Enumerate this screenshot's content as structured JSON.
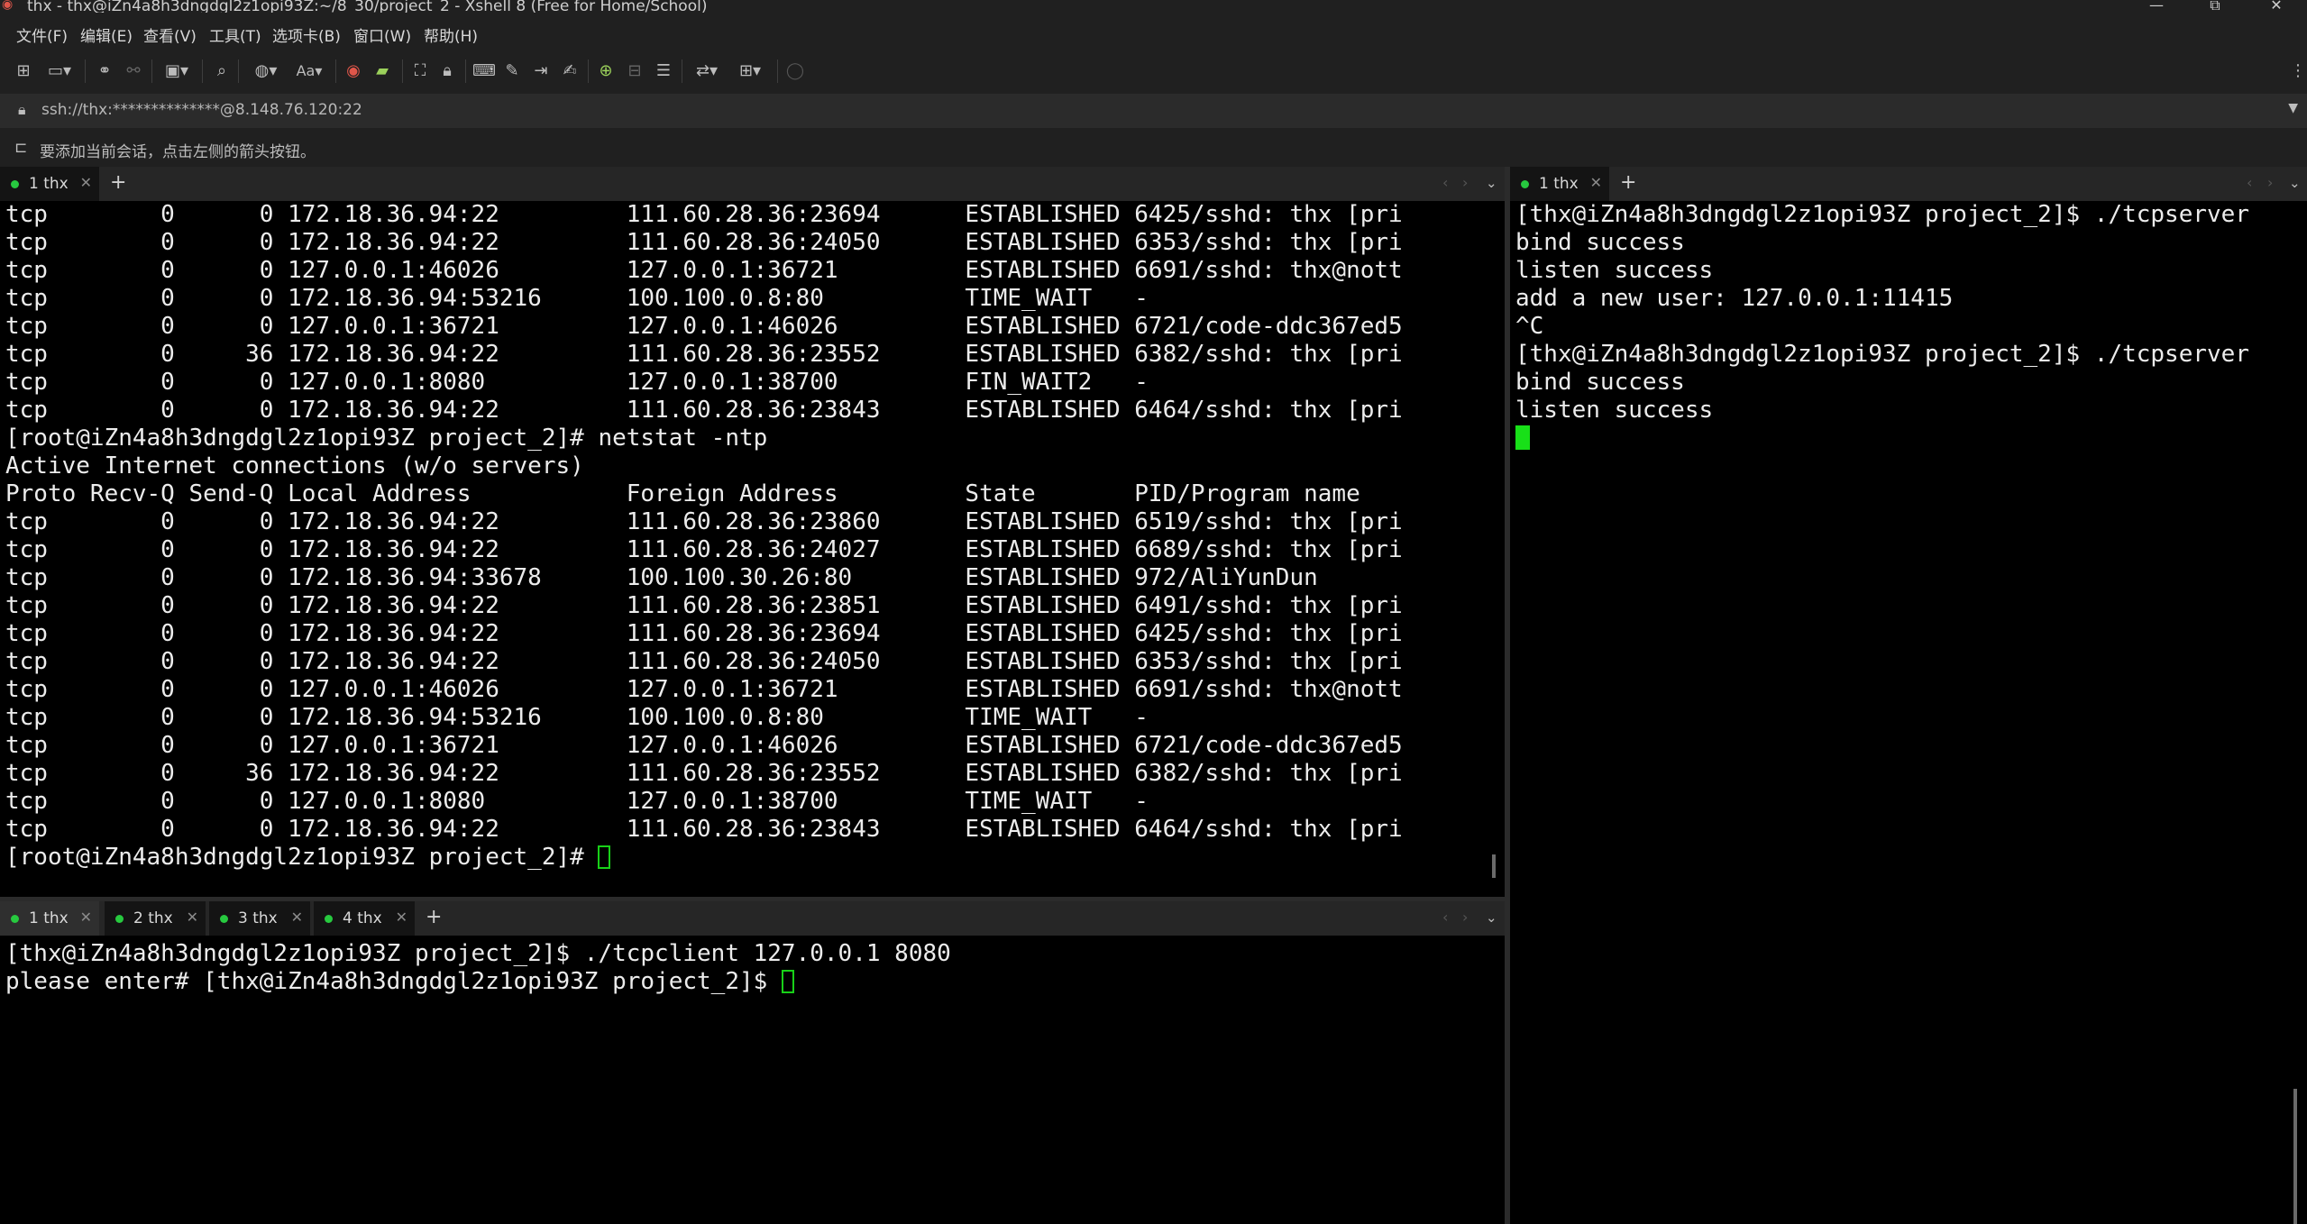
{
  "window": {
    "title": "thx - thx@iZn4a8h3dngdgl2z1opi93Z:~/8_30/project_2 - Xshell 8 (Free for Home/School)",
    "controls": {
      "minimize": "—",
      "maximize": "⧉",
      "close": "✕"
    }
  },
  "menu": {
    "items": [
      "文件(F)",
      "编辑(E)",
      "查看(V)",
      "工具(T)",
      "选项卡(B)",
      "窗口(W)",
      "帮助(H)"
    ]
  },
  "toolbar": {
    "font_label": "Aa",
    "icons": [
      "new-session-icon",
      "open-folder-icon",
      "connect-icon",
      "disconnect-icon",
      "new-window-icon",
      "find-icon",
      "globe-icon",
      "font-icon",
      "xshell-logo-icon",
      "xftp-icon",
      "fullscreen-icon",
      "lock-icon",
      "compose-icon",
      "highlight-icon",
      "send-icon",
      "script-icon",
      "new-tab-icon",
      "tab-group-icon",
      "log-icon",
      "transfer-icon",
      "layout-icon",
      "chat-icon",
      "more-icon"
    ]
  },
  "address": {
    "url": "ssh://thx:**************@8.148.76.120:22"
  },
  "hint": {
    "text": "要添加当前会话，点击左侧的箭头按钮。"
  },
  "left_top_pane": {
    "tab": {
      "label": "1 thx"
    },
    "lines": [
      "tcp        0      0 172.18.36.94:22         111.60.28.36:23694      ESTABLISHED 6425/sshd: thx [pri",
      "tcp        0      0 172.18.36.94:22         111.60.28.36:24050      ESTABLISHED 6353/sshd: thx [pri",
      "tcp        0      0 127.0.0.1:46026         127.0.0.1:36721         ESTABLISHED 6691/sshd: thx@nott",
      "tcp        0      0 172.18.36.94:53216      100.100.0.8:80          TIME_WAIT   -",
      "tcp        0      0 127.0.0.1:36721         127.0.0.1:46026         ESTABLISHED 6721/code-ddc367ed5",
      "tcp        0     36 172.18.36.94:22         111.60.28.36:23552      ESTABLISHED 6382/sshd: thx [pri",
      "tcp        0      0 127.0.0.1:8080          127.0.0.1:38700         FIN_WAIT2   -",
      "tcp        0      0 172.18.36.94:22         111.60.28.36:23843      ESTABLISHED 6464/sshd: thx [pri",
      "[root@iZn4a8h3dngdgl2z1opi93Z project_2]# netstat -ntp",
      "Active Internet connections (w/o servers)",
      "Proto Recv-Q Send-Q Local Address           Foreign Address         State       PID/Program name",
      "tcp        0      0 172.18.36.94:22         111.60.28.36:23860      ESTABLISHED 6519/sshd: thx [pri",
      "tcp        0      0 172.18.36.94:22         111.60.28.36:24027      ESTABLISHED 6689/sshd: thx [pri",
      "tcp        0      0 172.18.36.94:33678      100.100.30.26:80        ESTABLISHED 972/AliYunDun",
      "tcp        0      0 172.18.36.94:22         111.60.28.36:23851      ESTABLISHED 6491/sshd: thx [pri",
      "tcp        0      0 172.18.36.94:22         111.60.28.36:23694      ESTABLISHED 6425/sshd: thx [pri",
      "tcp        0      0 172.18.36.94:22         111.60.28.36:24050      ESTABLISHED 6353/sshd: thx [pri",
      "tcp        0      0 127.0.0.1:46026         127.0.0.1:36721         ESTABLISHED 6691/sshd: thx@nott",
      "tcp        0      0 172.18.36.94:53216      100.100.0.8:80          TIME_WAIT   -",
      "tcp        0      0 127.0.0.1:36721         127.0.0.1:46026         ESTABLISHED 6721/code-ddc367ed5",
      "tcp        0     36 172.18.36.94:22         111.60.28.36:23552      ESTABLISHED 6382/sshd: thx [pri",
      "tcp        0      0 127.0.0.1:8080          127.0.0.1:38700         TIME_WAIT   -",
      "tcp        0      0 172.18.36.94:22         111.60.28.36:23843      ESTABLISHED 6464/sshd: thx [pri"
    ],
    "prompt": "[root@iZn4a8h3dngdgl2z1opi93Z project_2]# "
  },
  "left_bottom_pane": {
    "tabs": [
      "1 thx",
      "2 thx",
      "3 thx",
      "4 thx"
    ],
    "lines": [
      "[thx@iZn4a8h3dngdgl2z1opi93Z project_2]$ ./tcpclient 127.0.0.1 8080"
    ],
    "prompt": "please enter# [thx@iZn4a8h3dngdgl2z1opi93Z project_2]$ "
  },
  "right_pane": {
    "tab": {
      "label": "1 thx"
    },
    "lines": [
      "[thx@iZn4a8h3dngdgl2z1opi93Z project_2]$ ./tcpserver",
      "bind success",
      "listen success",
      "add a new user: 127.0.0.1:11415",
      "^C",
      "[thx@iZn4a8h3dngdgl2z1opi93Z project_2]$ ./tcpserver",
      "bind success",
      "listen success"
    ]
  },
  "colors": {
    "cursor_green": "#18e018",
    "tab_dot_green": "#27c93f",
    "chrome_bg": "#202020"
  }
}
